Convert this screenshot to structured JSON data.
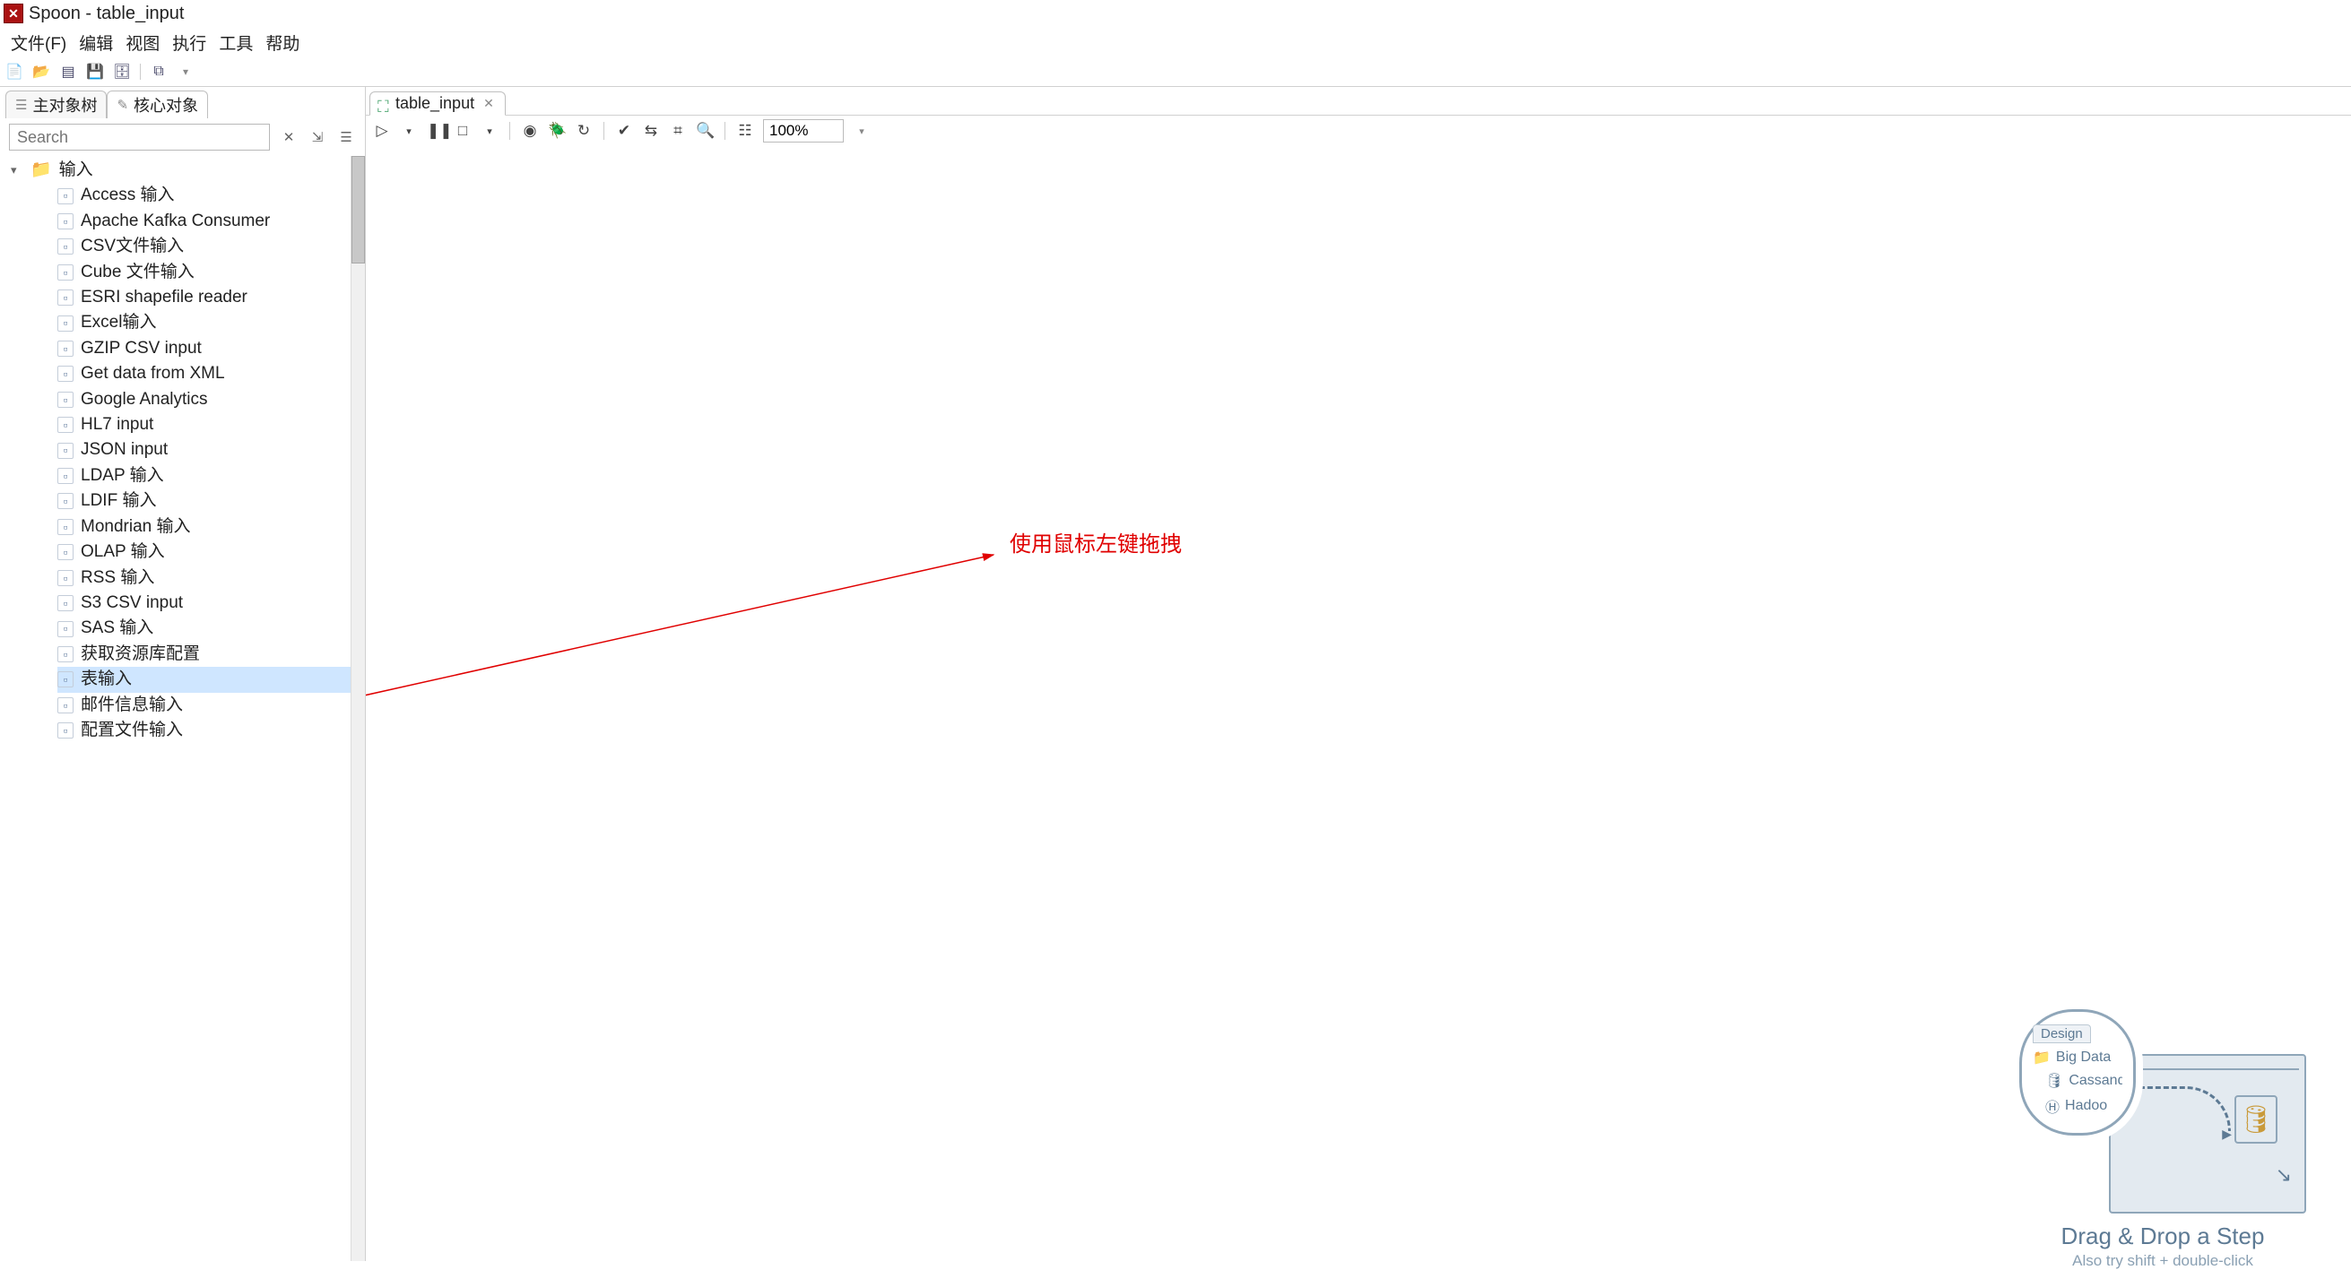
{
  "window": {
    "title": "Spoon - table_input"
  },
  "menu": {
    "file": "文件(F)",
    "edit": "编辑",
    "view": "视图",
    "run": "执行",
    "tools": "工具",
    "help": "帮助"
  },
  "sidebar": {
    "tabs": {
      "main": "主对象树",
      "core": "核心对象"
    },
    "search_placeholder": "Search",
    "folder": "输入",
    "items": [
      "Access 输入",
      "Apache Kafka Consumer",
      "CSV文件输入",
      "Cube 文件输入",
      "ESRI shapefile reader",
      "Excel输入",
      "GZIP CSV input",
      "Get data from XML",
      "Google Analytics",
      "HL7 input",
      "JSON input",
      "LDAP 输入",
      "LDIF 输入",
      "Mondrian 输入",
      "OLAP 输入",
      "RSS 输入",
      "S3 CSV input",
      "SAS 输入",
      "获取资源库配置",
      "表输入",
      "邮件信息输入",
      "配置文件输入"
    ],
    "selected_index": 19
  },
  "editor": {
    "tab": "table_input",
    "zoom": "100%"
  },
  "annotation": {
    "text": "使用鼠标左键拖拽"
  },
  "hint": {
    "tab": "Design",
    "folder": "Big Data",
    "items": [
      "Cassandr",
      "Hadoo"
    ],
    "title": "Drag & Drop a Step",
    "subtitle": "Also try shift + double-click"
  }
}
